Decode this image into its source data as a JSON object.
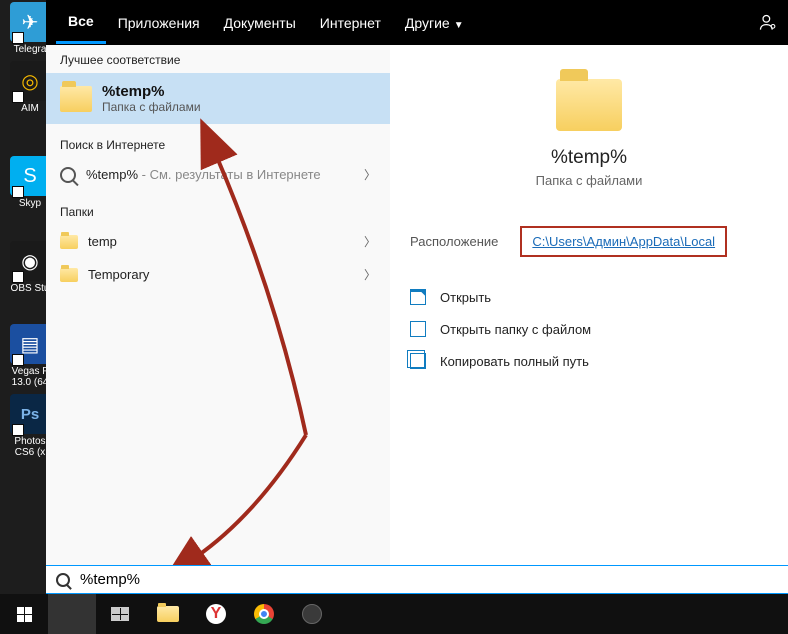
{
  "desktop_icons": [
    {
      "label": "Telegra",
      "color": "#2e9dd6",
      "glyph": "✈"
    },
    {
      "label": "AIM",
      "color": "#1a1a1a",
      "glyph": "◎"
    },
    {
      "label": "Skyp",
      "color": "#00aff0",
      "glyph": "S"
    },
    {
      "label": "OBS Stu",
      "color": "#1a1a1a",
      "glyph": "◉"
    },
    {
      "label": "Vegas F\n13.0 (64",
      "color": "#1b4fa0",
      "glyph": "▤"
    },
    {
      "label": "Photos\nCS6 (x",
      "color": "#0a2745",
      "glyph": "Ps"
    }
  ],
  "tabs": [
    "Все",
    "Приложения",
    "Документы",
    "Интернет",
    "Другие"
  ],
  "active_tab": 0,
  "left": {
    "best_match_label": "Лучшее соответствие",
    "best_title": "%temp%",
    "best_sub": "Папка с файлами",
    "web_section": "Поиск в Интернете",
    "web_item_prefix": "%temp%",
    "web_item_suffix": " - См. результаты в Интернете",
    "folders_section": "Папки",
    "folder_items": [
      "temp",
      "Temporary"
    ]
  },
  "preview": {
    "title": "%temp%",
    "sub": "Папка с файлами",
    "location_label": "Расположение",
    "location_path": "C:\\Users\\Админ\\AppData\\Local",
    "actions": [
      "Открыть",
      "Открыть папку с файлом",
      "Копировать полный путь"
    ]
  },
  "search_value": "%temp%"
}
